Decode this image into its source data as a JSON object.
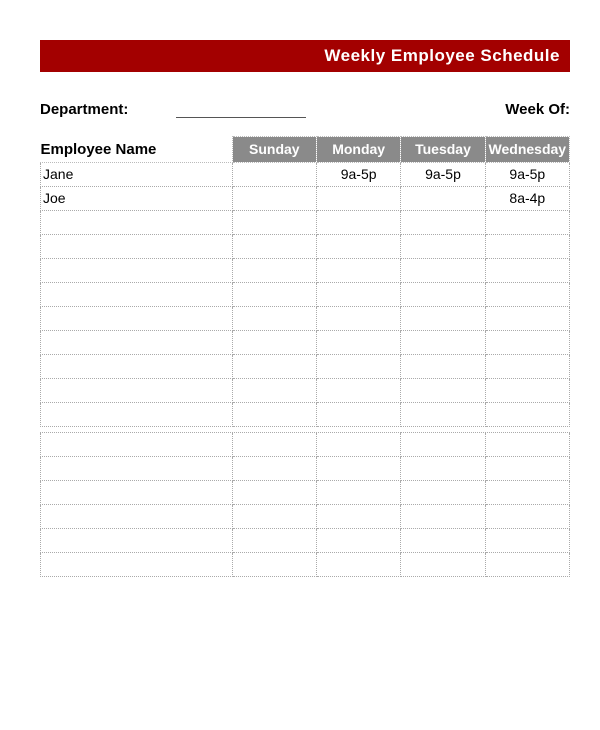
{
  "title": "Weekly Employee Schedule",
  "labels": {
    "department": "Department:",
    "weekOf": "Week Of:",
    "employeeName": "Employee Name"
  },
  "departmentValue": "",
  "days": [
    "Sunday",
    "Monday",
    "Tuesday",
    "Wednesday"
  ],
  "rows": [
    {
      "name": "Jane",
      "cells": [
        "",
        "9a-5p",
        "9a-5p",
        "9a-5p"
      ]
    },
    {
      "name": "Joe",
      "cells": [
        "",
        "",
        "",
        "8a-4p"
      ]
    },
    {
      "name": "",
      "cells": [
        "",
        "",
        "",
        ""
      ]
    },
    {
      "name": "",
      "cells": [
        "",
        "",
        "",
        ""
      ]
    },
    {
      "name": "",
      "cells": [
        "",
        "",
        "",
        ""
      ]
    },
    {
      "name": "",
      "cells": [
        "",
        "",
        "",
        ""
      ]
    },
    {
      "name": "",
      "cells": [
        "",
        "",
        "",
        ""
      ]
    },
    {
      "name": "",
      "cells": [
        "",
        "",
        "",
        ""
      ]
    },
    {
      "name": "",
      "cells": [
        "",
        "",
        "",
        ""
      ]
    },
    {
      "name": "",
      "cells": [
        "",
        "",
        "",
        ""
      ]
    },
    {
      "name": "",
      "cells": [
        "",
        "",
        "",
        ""
      ]
    }
  ],
  "rows2": [
    {
      "name": "",
      "cells": [
        "",
        "",
        "",
        ""
      ]
    },
    {
      "name": "",
      "cells": [
        "",
        "",
        "",
        ""
      ]
    },
    {
      "name": "",
      "cells": [
        "",
        "",
        "",
        ""
      ]
    },
    {
      "name": "",
      "cells": [
        "",
        "",
        "",
        ""
      ]
    },
    {
      "name": "",
      "cells": [
        "",
        "",
        "",
        ""
      ]
    },
    {
      "name": "",
      "cells": [
        "",
        "",
        "",
        ""
      ]
    }
  ]
}
